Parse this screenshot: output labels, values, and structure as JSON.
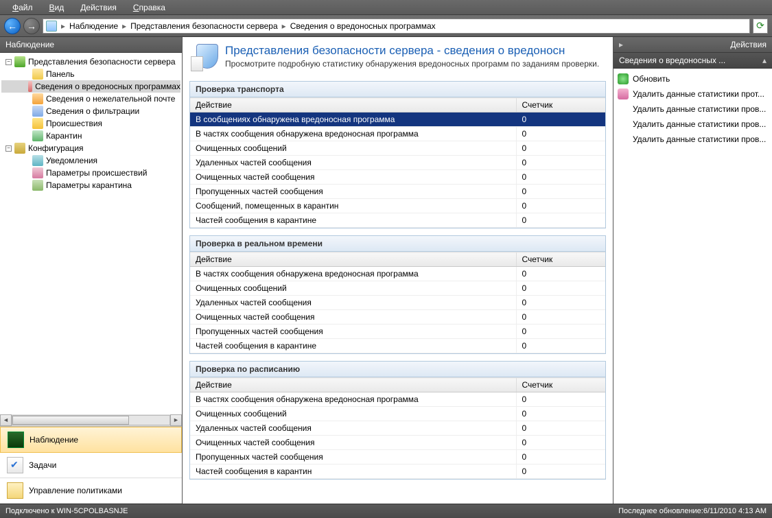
{
  "menu": {
    "file": "Файл",
    "view": "Вид",
    "actions": "Действия",
    "help": "Справка"
  },
  "breadcrumb": {
    "root": "Наблюдение",
    "b1": "Представления безопасности сервера",
    "b2": "Сведения о вредоносных программах",
    "sep": "▸"
  },
  "sidebar": {
    "title": "Наблюдение",
    "nodes": {
      "n0": "Представления безопасности сервера",
      "n1": "Панель",
      "n2": "Сведения о вредоносных программах",
      "n3": "Сведения о нежелательной почте",
      "n4": "Сведения о фильтрации",
      "n5": "Происшествия",
      "n6": "Карантин",
      "c0": "Конфигурация",
      "c1": "Уведомления",
      "c2": "Параметры происшествий",
      "c3": "Параметры карантина"
    },
    "nav": {
      "monitor": "Наблюдение",
      "tasks": "Задачи",
      "policies": "Управление политиками"
    }
  },
  "header": {
    "title": "Представления безопасности сервера - сведения о вредоносн",
    "sub": "Просмотрите подробную статистику обнаружения вредоносных программ по заданиям проверки."
  },
  "cols": {
    "action": "Действие",
    "counter": "Счетчик"
  },
  "sections": [
    {
      "title": "Проверка транспорта",
      "rows": [
        {
          "a": "В сообщениях обнаружена вредоносная программа",
          "c": "0",
          "sel": true
        },
        {
          "a": "В частях сообщения обнаружена вредоносная программа",
          "c": "0"
        },
        {
          "a": "Очищенных сообщений",
          "c": "0"
        },
        {
          "a": "Удаленных частей сообщения",
          "c": "0"
        },
        {
          "a": "Очищенных частей сообщения",
          "c": "0"
        },
        {
          "a": "Пропущенных частей сообщения",
          "c": "0"
        },
        {
          "a": "Сообщений, помещенных в карантин",
          "c": "0"
        },
        {
          "a": "Частей сообщения в карантине",
          "c": "0"
        }
      ]
    },
    {
      "title": "Проверка в реальном времени",
      "rows": [
        {
          "a": "В частях сообщения обнаружена вредоносная программа",
          "c": "0"
        },
        {
          "a": "Очищенных сообщений",
          "c": "0"
        },
        {
          "a": "Удаленных частей сообщения",
          "c": "0"
        },
        {
          "a": "Очищенных частей сообщения",
          "c": "0"
        },
        {
          "a": "Пропущенных частей сообщения",
          "c": "0"
        },
        {
          "a": "Частей сообщения в карантине",
          "c": "0"
        }
      ]
    },
    {
      "title": "Проверка по расписанию",
      "rows": [
        {
          "a": "В частях сообщения обнаружена вредоносная программа",
          "c": "0"
        },
        {
          "a": "Очищенных сообщений",
          "c": "0"
        },
        {
          "a": "Удаленных частей сообщения",
          "c": "0"
        },
        {
          "a": "Очищенных частей сообщения",
          "c": "0"
        },
        {
          "a": "Пропущенных частей сообщения",
          "c": "0"
        },
        {
          "a": "Частей сообщения в карантин",
          "c": "0"
        }
      ]
    }
  ],
  "actions": {
    "title": "Действия",
    "subtitle": "Сведения о вредоносных ...",
    "items": [
      {
        "label": "Обновить",
        "icon": "refresh"
      },
      {
        "label": "Удалить данные статистики прот...",
        "icon": "del"
      },
      {
        "label": "Удалить данные статистики пров...",
        "icon": ""
      },
      {
        "label": "Удалить данные статистики пров...",
        "icon": ""
      },
      {
        "label": "Удалить данные статистики пров...",
        "icon": ""
      }
    ]
  },
  "status": {
    "left": "Подключено к WIN-5CPOLBASNJE",
    "right": "Последнее обновление:6/11/2010 4:13 AM"
  }
}
